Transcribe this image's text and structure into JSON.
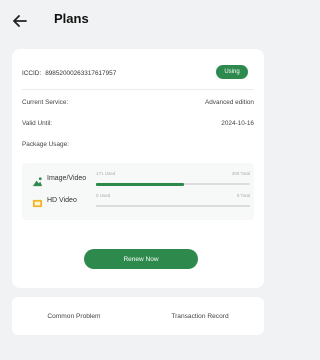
{
  "header": {
    "title": "Plans",
    "back_icon": "arrow-left-icon"
  },
  "card": {
    "iccid_label": "ICCID:",
    "iccid_value": "89852000263317617957",
    "status_badge": "Using",
    "rows": [
      {
        "label": "Current Service:",
        "value": "Advanced edition"
      },
      {
        "label": "Valid Until:",
        "value": "2024-10-16"
      },
      {
        "label": "Package Usage:",
        "value": ""
      }
    ],
    "usage": [
      {
        "icon": "image-icon",
        "label": "Image/Video",
        "used": "171 Used",
        "total": "300 Total",
        "fill_fraction": 0.57
      },
      {
        "icon": "hd-video-icon",
        "label": "HD Video",
        "used": "0 Used",
        "total": "0 Total",
        "fill_fraction": 0
      }
    ],
    "renew_label": "Renew Now"
  },
  "links": {
    "common_problem": "Common Problem",
    "transaction_record": "Transaction Record"
  },
  "colors": {
    "accent": "#2e8a4c",
    "background": "#f1f2f4",
    "card": "#ffffff",
    "hd_icon": "#f0b62a"
  }
}
